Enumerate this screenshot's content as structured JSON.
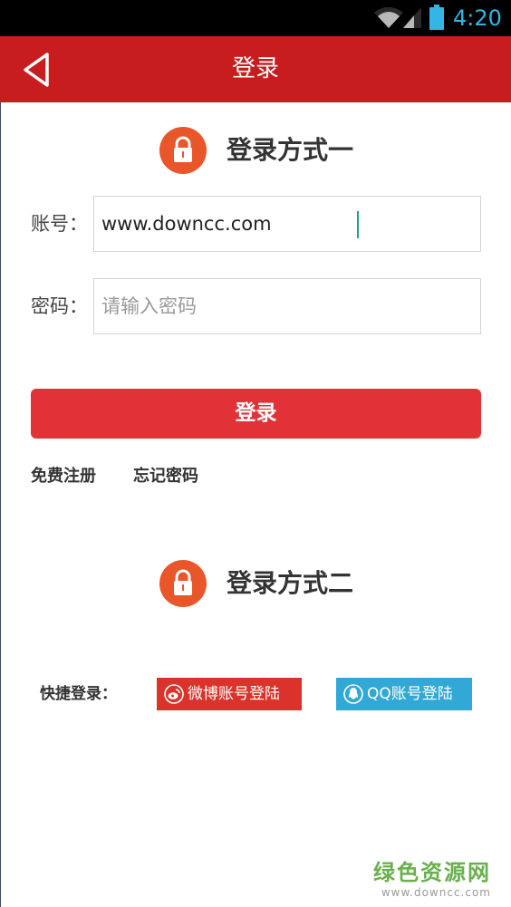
{
  "status_bar": {
    "time": "4:20"
  },
  "header": {
    "title": "登录"
  },
  "section1": {
    "title": "登录方式一"
  },
  "form": {
    "account_label": "账号：",
    "account_value": "www.downcc.com",
    "password_label": "密码：",
    "password_placeholder": "请输入密码"
  },
  "login_button": "登录",
  "links": {
    "register": "免费注册",
    "forgot": "忘记密码"
  },
  "section2": {
    "title": "登录方式二"
  },
  "quick_login": {
    "label": "快捷登录：",
    "weibo": "微博账号登陆",
    "qq": "QQ账号登陆"
  },
  "watermark": {
    "cn": "绿色资源网",
    "en": "www.downcc.com"
  },
  "colors": {
    "header": "#c71d1f",
    "button": "#e03237",
    "lock": "#e8562a",
    "weibo": "#d9332b",
    "qq": "#31a8d6",
    "status_text": "#33b5e5"
  }
}
